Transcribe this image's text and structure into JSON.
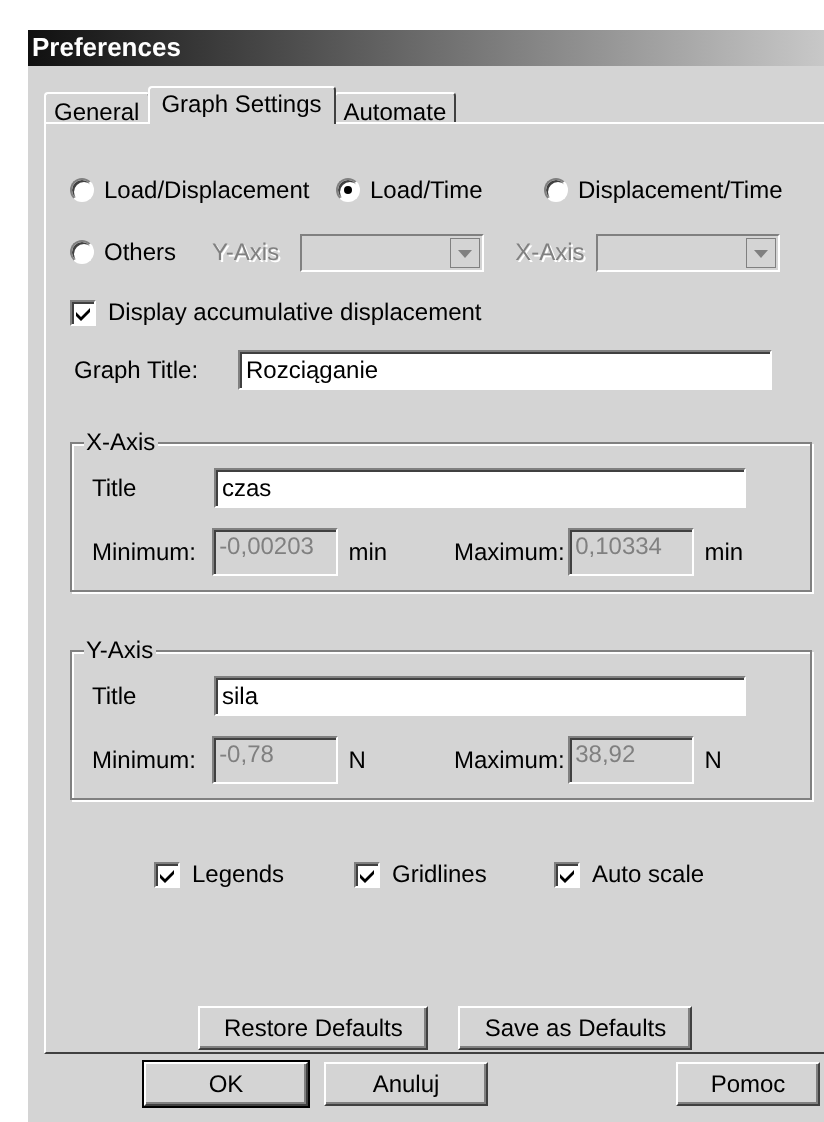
{
  "window": {
    "title": "Preferences"
  },
  "tabs": [
    {
      "label": "General",
      "selected": false
    },
    {
      "label": "Graph Settings",
      "selected": true
    },
    {
      "label": "Automate",
      "selected": false
    }
  ],
  "graph_type": [
    {
      "label": "Load/Displacement",
      "selected": false
    },
    {
      "label": "Load/Time",
      "selected": true
    },
    {
      "label": "Displacement/Time",
      "selected": false
    },
    {
      "label": "Others",
      "selected": false
    }
  ],
  "others": [
    {
      "label": "Y-Axis",
      "disabled": true
    },
    {
      "label": "X-Axis",
      "disabled": true
    }
  ],
  "accumulative": {
    "label": "Display accumulative displacement",
    "checked": true
  },
  "graph_title": {
    "label": "Graph Title:",
    "value": "Rozciąganie"
  },
  "axes": [
    {
      "legend": "X-Axis",
      "title_label": "Title",
      "title": "czas",
      "minimum": {
        "label": "Minimum:",
        "value": "-0,00203",
        "unit": "min",
        "disabled": true
      },
      "maximum": {
        "label": "Maximum:",
        "value": "0,10334",
        "unit": "min",
        "disabled": true
      }
    },
    {
      "legend": "Y-Axis",
      "title_label": "Title",
      "title": "sila",
      "minimum": {
        "label": "Minimum:",
        "value": "-0,78",
        "unit": "N",
        "disabled": true
      },
      "maximum": {
        "label": "Maximum:",
        "value": "38,92",
        "unit": "N",
        "disabled": true
      }
    }
  ],
  "options": [
    {
      "label": "Legends",
      "checked": true
    },
    {
      "label": "Gridlines",
      "checked": true
    },
    {
      "label": "Auto scale",
      "checked": true
    }
  ],
  "panel_buttons": [
    "Restore Defaults",
    "Save as Defaults"
  ],
  "buttons": [
    {
      "label": "OK",
      "default": true
    },
    {
      "label": "Anuluj",
      "default": false
    },
    {
      "label": "Pomoc",
      "default": false
    }
  ]
}
